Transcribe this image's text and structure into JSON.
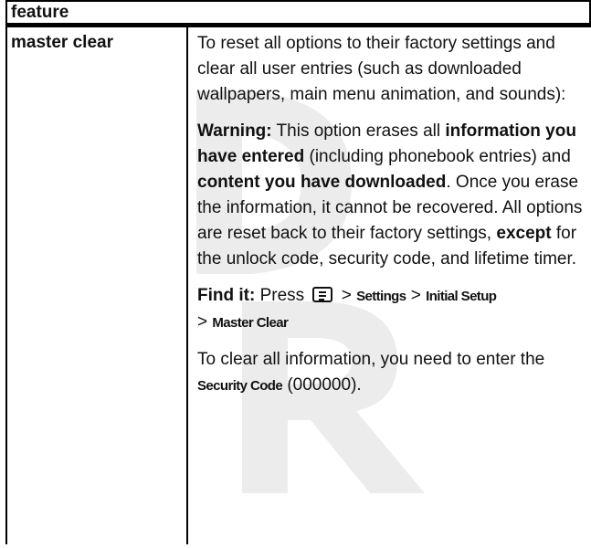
{
  "table": {
    "header": "feature",
    "feature_name": "master clear"
  },
  "description": {
    "intro": "To reset all options to their factory settings and clear all user entries (such as downloaded wallpapers, main menu animation, and sounds):",
    "warning_label": "Warning:",
    "warning_text_1": " This option erases all ",
    "warning_bold_1": "information you have entered",
    "warning_text_2": " (including phonebook entries) and ",
    "warning_bold_2": "content you have downloaded",
    "warning_text_3": ". Once you erase the information, it cannot be recovered. All options are reset back to their factory settings, ",
    "warning_bold_3": "except",
    "warning_text_4": " for the unlock code, security code, and lifetime timer.",
    "find_label": "Find it:",
    "find_press": " Press ",
    "find_sep1": " > ",
    "find_path_1": "Settings",
    "find_sep2": " > ",
    "find_path_2": "Initial Setup",
    "find_sep3": " > ",
    "find_path_3": "Master Clear",
    "clear_text_1": "To clear all information, you need to enter the ",
    "clear_code_label": "Security Code",
    "clear_text_2": " (000000)."
  },
  "icons": {
    "menu_key": "menu-key-icon"
  },
  "colors": {
    "watermark": "#ececec",
    "text": "#111111"
  }
}
